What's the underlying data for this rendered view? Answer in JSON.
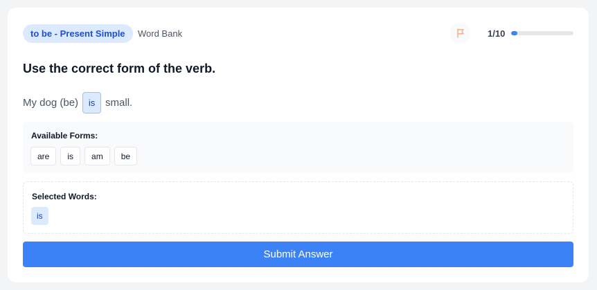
{
  "header": {
    "topic": "to be - Present Simple",
    "mode": "Word Bank",
    "flag_icon": "flag-icon",
    "progress_label": "1/10",
    "progress_fraction": 0.1,
    "accent_color": "#3b82f6",
    "flag_color": "#f4a582"
  },
  "question": {
    "instruction": "Use the correct form of the verb.",
    "before": "My dog (be)",
    "answer": "is",
    "after": "small."
  },
  "available_forms": {
    "title": "Available Forms:",
    "options": [
      "are",
      "is",
      "am",
      "be"
    ]
  },
  "selected_words": {
    "title": "Selected Words:",
    "words": [
      "is"
    ]
  },
  "submit": {
    "label": "Submit Answer"
  }
}
